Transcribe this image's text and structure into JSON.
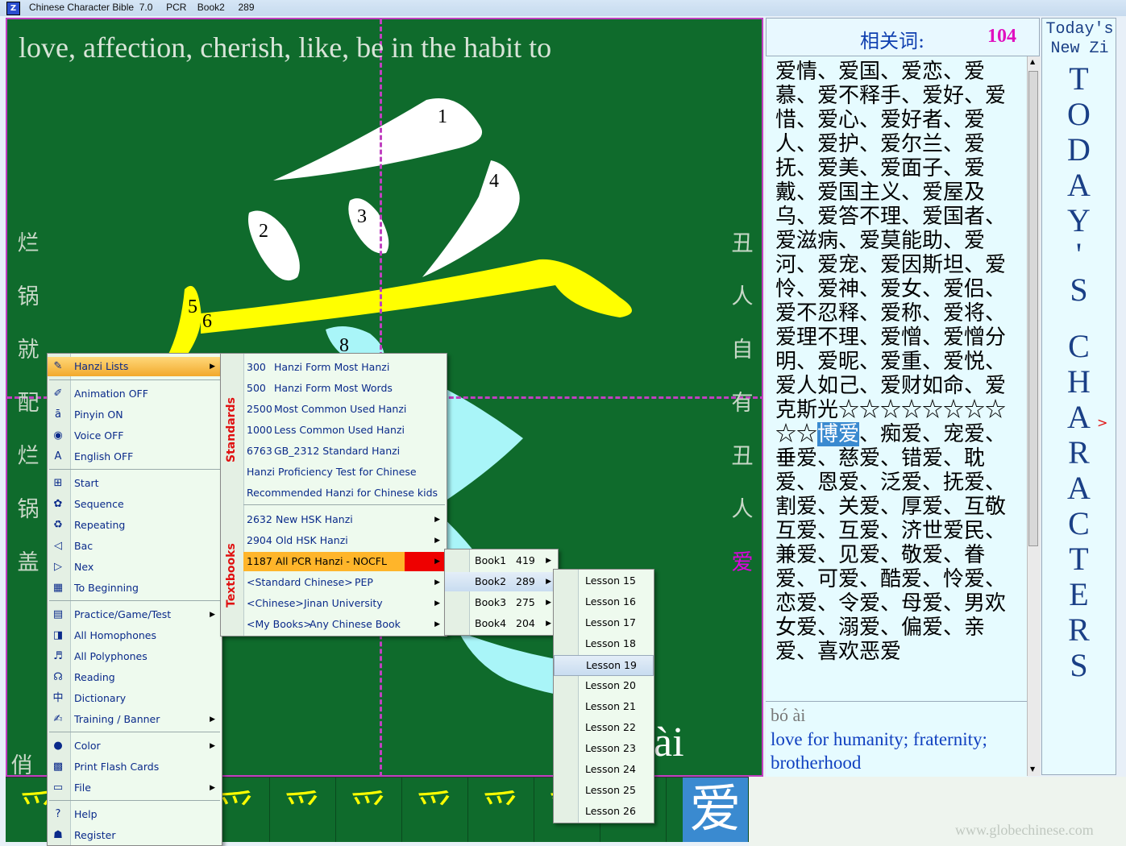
{
  "window": {
    "app_title": "Chinese Character Bible  7.0",
    "textbook": "PCR",
    "book": "Book2",
    "count": "289"
  },
  "canvas": {
    "meaning": "love, affection, cherish, like, be in the habit to",
    "left_column": [
      "烂",
      "锅",
      "就",
      "配",
      "烂",
      "锅",
      "盖"
    ],
    "left_bottom": "俏",
    "right_column": [
      "丑",
      "人",
      "自",
      "有",
      "丑",
      "人"
    ],
    "right_highlight": "爱",
    "stroke_numbers": [
      "1",
      "2",
      "3",
      "4",
      "5",
      "6",
      "8"
    ],
    "pinyin": "ài"
  },
  "thumbnails": [
    "爫",
    "爫",
    "爫",
    "爫",
    "爫",
    "爫",
    "爫",
    "爫",
    "爫",
    "爫",
    "爱"
  ],
  "related": {
    "label": "相关词:",
    "count": "104",
    "text_before": "爱情、爱国、爱恋、爱慕、爱不释手、爱好、爱惜、爱心、爱好者、爱人、爱护、爱尔兰、爱抚、爱美、爱面子、爱戴、爱国主义、爱屋及乌、爱答不理、爱国者、爱滋病、爱莫能助、爱河、爱宠、爱因斯坦、爱怜、爱神、爱女、爱侣、爱不忍释、爱称、爱将、爱理不理、爱憎、爱憎分明、爱昵、爱重、爱悦、爱人如己、爱财如命、爱克斯光",
    "stars": "☆☆☆☆☆☆☆☆☆☆",
    "highlighted": "博爱",
    "text_after": "、痴爱、宠爱、垂爱、慈爱、错爱、耽爱、恩爱、泛爱、抚爱、割爱、关爱、厚爱、互敬互爱、互爱、济世爱民、兼爱、见爱、敬爱、眷爱、可爱、酷爱、怜爱、恋爱、令爱、母爱、男欢女爱、溺爱、偏爱、亲爱、喜欢恶爱"
  },
  "detail": {
    "pinyin": "bó ài",
    "meaning": "love for humanity; fraternity; brotherhood"
  },
  "today": {
    "header1": "Today's",
    "header2": "New Zi",
    "vertical": [
      "T",
      "O",
      "D",
      "A",
      "Y",
      "'",
      "S",
      "C",
      "H",
      "A",
      "R",
      "A",
      "C",
      "T",
      "E",
      "R",
      "S"
    ],
    "arrow": ">"
  },
  "watermark": "www.globechinese.com",
  "main_menu": {
    "items": [
      {
        "label": "Hanzi Lists",
        "icon": "hanzi-lists-icon",
        "glyph": "✎",
        "submenu": true
      },
      {
        "label": "Animation OFF",
        "icon": "brush-icon",
        "glyph": "✐"
      },
      {
        "label": "Pinyin ON",
        "icon": "pinyin-icon",
        "glyph": "ā"
      },
      {
        "label": "Voice OFF",
        "icon": "speaker-icon",
        "glyph": "◉"
      },
      {
        "label": "English OFF",
        "icon": "english-icon",
        "glyph": "A"
      },
      {
        "label": "Start",
        "icon": "windows-flag-icon",
        "glyph": "⊞"
      },
      {
        "label": "Sequence",
        "icon": "flower-icon",
        "glyph": "✿"
      },
      {
        "label": "Repeating",
        "icon": "recycle-icon",
        "glyph": "♻"
      },
      {
        "label": "Bac",
        "icon": "back-arrow-icon",
        "glyph": "◁"
      },
      {
        "label": "Nex",
        "icon": "next-arrow-icon",
        "glyph": "▷"
      },
      {
        "label": "To Beginning",
        "icon": "grid-icon",
        "glyph": "▦"
      },
      {
        "label": "Practice/Game/Test",
        "icon": "practice-icon",
        "glyph": "▤",
        "submenu": true
      },
      {
        "label": "All Homophones",
        "icon": "homophones-icon",
        "glyph": "◨"
      },
      {
        "label": "All Polyphones",
        "icon": "polyphones-icon",
        "glyph": "♬"
      },
      {
        "label": "Reading",
        "icon": "reading-icon",
        "glyph": "☊"
      },
      {
        "label": "Dictionary",
        "icon": "dictionary-icon",
        "glyph": "中"
      },
      {
        "label": "Training / Banner",
        "icon": "training-icon",
        "glyph": "✍",
        "submenu": true
      },
      {
        "label": "Color",
        "icon": "color-balloon-icon",
        "glyph": "●",
        "submenu": true
      },
      {
        "label": "Print Flash Cards",
        "icon": "flash-cards-icon",
        "glyph": "▩"
      },
      {
        "label": "File",
        "icon": "file-icon",
        "glyph": "▭",
        "submenu": true
      },
      {
        "label": "Help",
        "icon": "help-icon",
        "glyph": "?"
      },
      {
        "label": "Register",
        "icon": "register-icon",
        "glyph": "☗"
      }
    ]
  },
  "lists_menu": {
    "standards_label": "Standards",
    "textbooks_label": "Textbooks",
    "standards": [
      {
        "num": "300",
        "label": "Hanzi Form Most Hanzi"
      },
      {
        "num": "500",
        "label": "Hanzi Form Most Words"
      },
      {
        "num": "2500",
        "label": "Most Common Used Hanzi"
      },
      {
        "num": "1000",
        "label": "Less Common Used Hanzi"
      },
      {
        "num": "6763",
        "label": "GB_2312 Standard Hanzi"
      },
      {
        "num": "",
        "label": "Hanzi Proficiency Test for Chinese"
      },
      {
        "num": "",
        "label": "Recommended Hanzi for Chinese kids"
      }
    ],
    "textbooks": [
      {
        "num": "2632",
        "label": "New HSK Hanzi"
      },
      {
        "num": "2904",
        "label": "Old HSK Hanzi"
      },
      {
        "num": "1187",
        "label": "All PCR Hanzi - NOCFL"
      },
      {
        "num": "<Standard Chinese>",
        "label": "PEP"
      },
      {
        "num": "<Chinese>",
        "label": "Jinan University"
      },
      {
        "num": "<My Books>",
        "label": "Any Chinese Book"
      }
    ]
  },
  "books_menu": [
    {
      "label": "Book1",
      "count": "419"
    },
    {
      "label": "Book2",
      "count": "289"
    },
    {
      "label": "Book3",
      "count": "275"
    },
    {
      "label": "Book4",
      "count": "204"
    }
  ],
  "lessons_menu": [
    "Lesson 15",
    "Lesson 16",
    "Lesson 17",
    "Lesson 18",
    "Lesson 19",
    "Lesson 20",
    "Lesson 21",
    "Lesson 22",
    "Lesson 23",
    "Lesson 24",
    "Lesson 25",
    "Lesson 26"
  ]
}
